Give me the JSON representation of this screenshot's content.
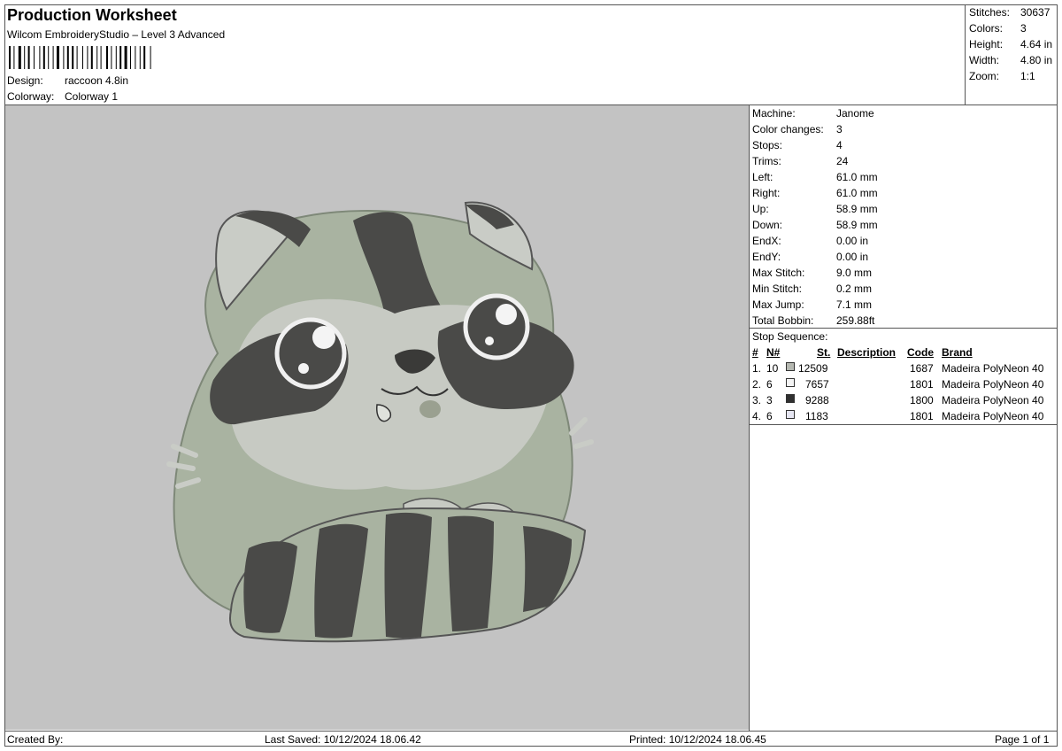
{
  "header": {
    "title": "Production Worksheet",
    "software": "Wilcom EmbroideryStudio – Level 3 Advanced",
    "design_label": "Design:",
    "design_value": "raccoon 4.8in",
    "colorway_label": "Colorway:",
    "colorway_value": "Colorway 1"
  },
  "summary": [
    {
      "label": "Stitches:",
      "value": "30637"
    },
    {
      "label": "Colors:",
      "value": "3"
    },
    {
      "label": "Height:",
      "value": "4.64 in"
    },
    {
      "label": "Width:",
      "value": "4.80 in"
    },
    {
      "label": "Zoom:",
      "value": "1:1"
    }
  ],
  "details": [
    {
      "label": "Machine:",
      "value": "Janome"
    },
    {
      "label": "Color changes:",
      "value": "3"
    },
    {
      "label": "Stops:",
      "value": "4"
    },
    {
      "label": "Trims:",
      "value": "24"
    },
    {
      "label": "Left:",
      "value": "61.0 mm"
    },
    {
      "label": "Right:",
      "value": "61.0 mm"
    },
    {
      "label": "Up:",
      "value": "58.9 mm"
    },
    {
      "label": "Down:",
      "value": "58.9 mm"
    },
    {
      "label": "EndX:",
      "value": "0.00 in"
    },
    {
      "label": "EndY:",
      "value": "0.00 in"
    },
    {
      "label": "Max Stitch:",
      "value": "9.0 mm"
    },
    {
      "label": "Min Stitch:",
      "value": "0.2 mm"
    },
    {
      "label": "Max Jump:",
      "value": "7.1 mm"
    },
    {
      "label": "Total Bobbin:",
      "value": "259.88ft"
    }
  ],
  "stop_sequence": {
    "title": "Stop Sequence:",
    "headers": {
      "num": "#",
      "n": "N#",
      "st": "St.",
      "description": "Description",
      "code": "Code",
      "brand": "Brand"
    },
    "rows": [
      {
        "index": "1.",
        "n": "10",
        "swatch": "#b5b8b1",
        "st": "12509",
        "code": "1687",
        "brand": "Madeira PolyNeon 40"
      },
      {
        "index": "2.",
        "n": "6",
        "swatch": "#f4f4f4",
        "st": "7657",
        "code": "1801",
        "brand": "Madeira PolyNeon 40"
      },
      {
        "index": "3.",
        "n": "3",
        "swatch": "#303030",
        "st": "9288",
        "code": "1800",
        "brand": "Madeira PolyNeon 40"
      },
      {
        "index": "4.",
        "n": "6",
        "swatch": "#e6e6f2",
        "st": "1183",
        "code": "1801",
        "brand": "Madeira PolyNeon 40"
      }
    ]
  },
  "footer": {
    "created_by": "Created By:",
    "last_saved": "Last Saved: 10/12/2024 18.06.42",
    "printed": "Printed: 10/12/2024 18.06.45",
    "page": "Page 1 of 1"
  }
}
